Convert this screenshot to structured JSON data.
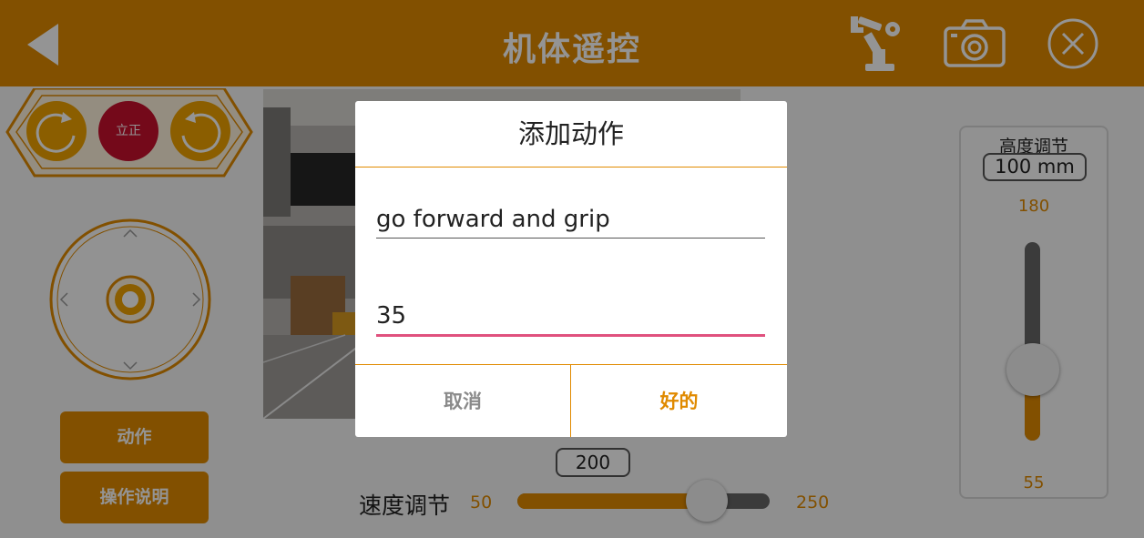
{
  "header": {
    "title": "机体遥控"
  },
  "left_panel": {
    "upright_label": "立正",
    "action_button": "动作",
    "instructions_button": "操作说明"
  },
  "speed": {
    "label": "速度调节",
    "value": "200",
    "min": "50",
    "max": "250",
    "fraction": 0.75
  },
  "height": {
    "label": "高度调节",
    "value": "100 mm",
    "max": "180",
    "min": "55",
    "fraction": 0.36
  },
  "dialog": {
    "title": "添加动作",
    "name_value": "go forward and grip",
    "number_value": "35",
    "cancel_label": "取消",
    "ok_label": "好的"
  },
  "colors": {
    "accent": "#e08a00",
    "focus_line": "#e0517e",
    "upright_button": "#c8102e"
  },
  "icons": [
    "back-icon",
    "robot-arm-icon",
    "camera-icon",
    "close-icon",
    "rotate-left-icon",
    "rotate-right-icon",
    "joystick-icon"
  ]
}
